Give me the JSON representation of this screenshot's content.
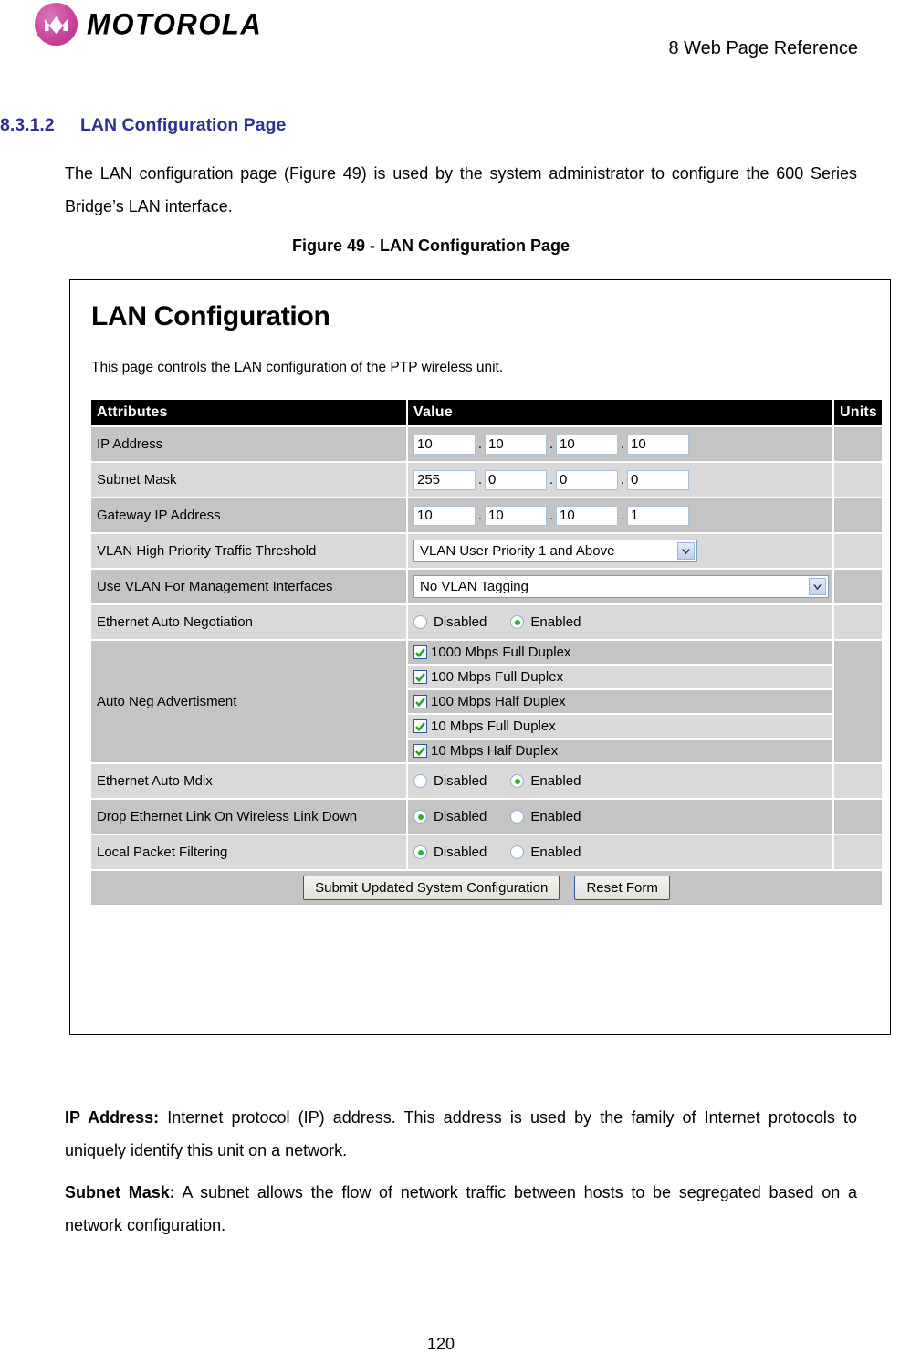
{
  "header": {
    "brand": "MOTOROLA",
    "logo_color": "#c8459b",
    "chapter": "8 Web Page Reference"
  },
  "section": {
    "number": "8.3.1.2",
    "title": "LAN Configuration Page",
    "color": "#2e3192"
  },
  "intro_paragraph": "The LAN configuration page (Figure 49) is used by the system administrator to configure the 600 Series Bridge’s LAN interface.",
  "figure_caption": "Figure 49 - LAN Configuration Page",
  "screenshot": {
    "title": "LAN Configuration",
    "description": "This page controls the LAN configuration of the PTP wireless unit.",
    "table_headers": {
      "attributes": "Attributes",
      "value": "Value",
      "units": "Units"
    },
    "rows": {
      "ip_address": {
        "label": "IP Address",
        "octets": [
          "10",
          "10",
          "10",
          "10"
        ],
        "units": ""
      },
      "subnet_mask": {
        "label": "Subnet Mask",
        "octets": [
          "255",
          "0",
          "0",
          "0"
        ],
        "units": ""
      },
      "gateway_ip_address": {
        "label": "Gateway IP Address",
        "octets": [
          "10",
          "10",
          "10",
          "1"
        ],
        "units": ""
      },
      "vlan_high_priority": {
        "label": "VLAN High Priority Traffic Threshold",
        "selected": "VLAN User Priority 1 and Above",
        "units": ""
      },
      "use_vlan_mgmt": {
        "label": "Use VLAN For Management Interfaces",
        "selected": "No VLAN Tagging",
        "units": ""
      },
      "ethernet_auto_negotiation": {
        "label": "Ethernet Auto Negotiation",
        "options": [
          "Disabled",
          "Enabled"
        ],
        "selected": "Enabled",
        "units": ""
      },
      "auto_neg_advertisment": {
        "label": "Auto Neg Advertisment",
        "checkboxes": [
          {
            "label": "1000 Mbps Full Duplex",
            "checked": true
          },
          {
            "label": "100 Mbps Full Duplex",
            "checked": true
          },
          {
            "label": "100 Mbps Half Duplex",
            "checked": true
          },
          {
            "label": "10 Mbps Full Duplex",
            "checked": true
          },
          {
            "label": "10 Mbps Half Duplex",
            "checked": true
          }
        ],
        "units": ""
      },
      "ethernet_auto_mdix": {
        "label": "Ethernet Auto Mdix",
        "options": [
          "Disabled",
          "Enabled"
        ],
        "selected": "Enabled",
        "units": ""
      },
      "drop_ethernet_link": {
        "label": "Drop Ethernet Link On Wireless Link Down",
        "options": [
          "Disabled",
          "Enabled"
        ],
        "selected": "Disabled",
        "units": ""
      },
      "local_packet_filtering": {
        "label": "Local Packet Filtering",
        "options": [
          "Disabled",
          "Enabled"
        ],
        "selected": "Disabled",
        "units": ""
      }
    },
    "buttons": {
      "submit": "Submit Updated System Configuration",
      "reset": "Reset Form"
    }
  },
  "definitions": {
    "ip_address_term": "IP Address:",
    "ip_address_text": " Internet protocol (IP) address. This address is used by the family of Internet protocols to uniquely identify this unit on a network.",
    "subnet_mask_term": "Subnet Mask:",
    "subnet_mask_text": " A subnet allows the flow of network traffic between hosts to be segregated based on a network configuration."
  },
  "page_number": "120"
}
